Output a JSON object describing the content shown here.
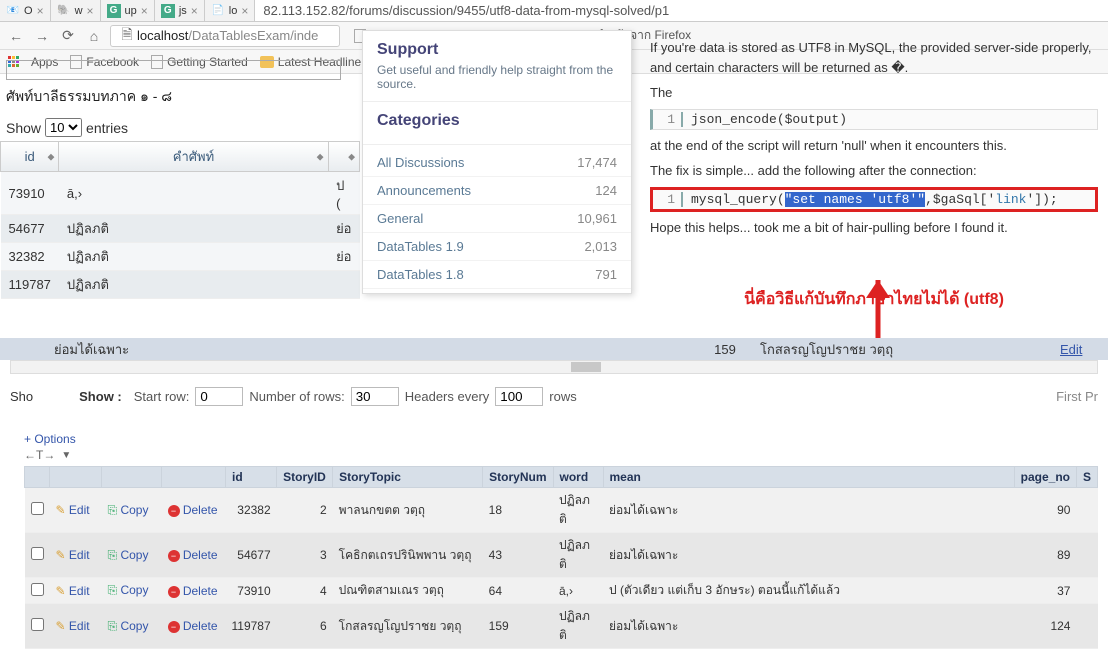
{
  "tabs": [
    {
      "fav": "📧",
      "label": "O"
    },
    {
      "fav": "🐘",
      "label": "w"
    },
    {
      "fav": "G",
      "label": "up"
    },
    {
      "fav": "G",
      "label": "js"
    },
    {
      "fav": "📄",
      "label": "lo"
    }
  ],
  "url_top": "82.113.152.82/forums/discussion/9455/utf8-data-from-mysql-solved/p1",
  "nav": {
    "back": "←",
    "fwd": "→",
    "reload": "⟳",
    "home": "⌂",
    "doc": "🗎"
  },
  "omnibox": {
    "host": "localhost",
    "path": "/DataTablesExam/inde"
  },
  "bm_right": [
    {
      "icon": "page",
      "label": "Getting Started"
    },
    {
      "icon": "folder",
      "label": "Latest Headlines"
    },
    {
      "icon": "folder",
      "label": "นำเข้าจาก Firefox"
    }
  ],
  "bm_left": {
    "apps": "Apps",
    "items": [
      {
        "icon": "page",
        "label": "Facebook"
      },
      {
        "icon": "page",
        "label": "Getting Started"
      },
      {
        "icon": "folder",
        "label": "Latest Headline"
      }
    ]
  },
  "leftpage": {
    "title": "ศัพท์บาลีธรรมบทภาค ๑ - ๘",
    "len_show": "Show",
    "len_val": "10",
    "len_entries": "entries",
    "cols": {
      "id": "id",
      "term": "คำศัพท์"
    },
    "rows": [
      {
        "id": "73910",
        "term": "ā,›",
        "r": "ป ("
      },
      {
        "id": "54677",
        "term": "ปฏิลภติ",
        "r": "ย่อ"
      },
      {
        "id": "32382",
        "term": "ปฏิลภติ",
        "r": "ย่อ"
      },
      {
        "id": "119787",
        "term": "ปฏิลภติ",
        "r": ""
      }
    ]
  },
  "popup": {
    "support_h": "Support",
    "support_sub": "Get useful and friendly help straight from the source.",
    "cat_h": "Categories",
    "cats": [
      {
        "name": "All Discussions",
        "count": "17,474"
      },
      {
        "name": "Announcements",
        "count": "124"
      },
      {
        "name": "General",
        "count": "10,961"
      },
      {
        "name": "DataTables 1.9",
        "count": "2,013"
      },
      {
        "name": "DataTables 1.8",
        "count": "791"
      }
    ]
  },
  "forum": {
    "p1": "If you're data is stored as UTF8 in MySQL, the provided server-side properly, and certain characters will be returned as �.",
    "p2": "The",
    "code1": {
      "ln": "1",
      "txt": "json_encode($output)"
    },
    "p3": "at the end of the script will return 'null' when it encounters this.",
    "p4": "The fix is simple... add the following after the connection:",
    "code2": {
      "ln": "1",
      "pre": "mysql_query(",
      "hl": "\"set names 'utf8'\"",
      "mid": ",$gaSql['",
      "link": "link",
      "post": "']);"
    },
    "p5": "Hope this helps... took me a bit of hair-pulling before I found it.",
    "rednote": "นี่คือวิธีแก้บันทึกภาษาไทยไม่ได้ (utf8)"
  },
  "extrarow": {
    "c1": "",
    "c2": "ย่อมได้เฉพาะ",
    "c3": "",
    "c4": "159",
    "c5": "โกสลรญโญปราชย วตฺถุ",
    "c6": "Edit"
  },
  "status": {
    "sho": "Sho",
    "show": "Show :",
    "start": "Start row:",
    "start_v": "0",
    "num": "Number of rows:",
    "num_v": "30",
    "hdr": "Headers every",
    "hdr_v": "100",
    "rows": "rows",
    "fp": "First  Pr"
  },
  "pma": {
    "options": "+ Options",
    "arrows": "←T→",
    "head": [
      "",
      "",
      "",
      "",
      "id",
      "StoryID",
      "StoryTopic",
      "StoryNum",
      "word",
      "mean",
      "page_no",
      "S"
    ],
    "rows": [
      {
        "id": "32382",
        "sid": "2",
        "topic": "พาลนกขตต วตฺถุ",
        "snum": "18",
        "word": "ปฏิลภติ",
        "mean": "ย่อมได้เฉพาะ",
        "pn": "90"
      },
      {
        "id": "54677",
        "sid": "3",
        "topic": "โคธิกตเถรปรินิพพาน วตฺถุ",
        "snum": "43",
        "word": "ปฏิลภติ",
        "mean": "ย่อมได้เฉพาะ",
        "pn": "89"
      },
      {
        "id": "73910",
        "sid": "4",
        "topic": "ปณฑิตสามเณร วตฺถุ",
        "snum": "64",
        "word": "ā,›",
        "mean": "ป (ตัวเดียว แต่เก็บ 3 อักษระ) ตอนนี้แก้ได้แล้ว",
        "pn": "37"
      },
      {
        "id": "119787",
        "sid": "6",
        "topic": "โกสลรญโญปราชย วตฺถุ",
        "snum": "159",
        "word": "ปฏิลภติ",
        "mean": "ย่อมได้เฉพาะ",
        "pn": "124"
      }
    ],
    "act": {
      "edit": "Edit",
      "copy": "Copy",
      "delete": "Delete"
    }
  }
}
